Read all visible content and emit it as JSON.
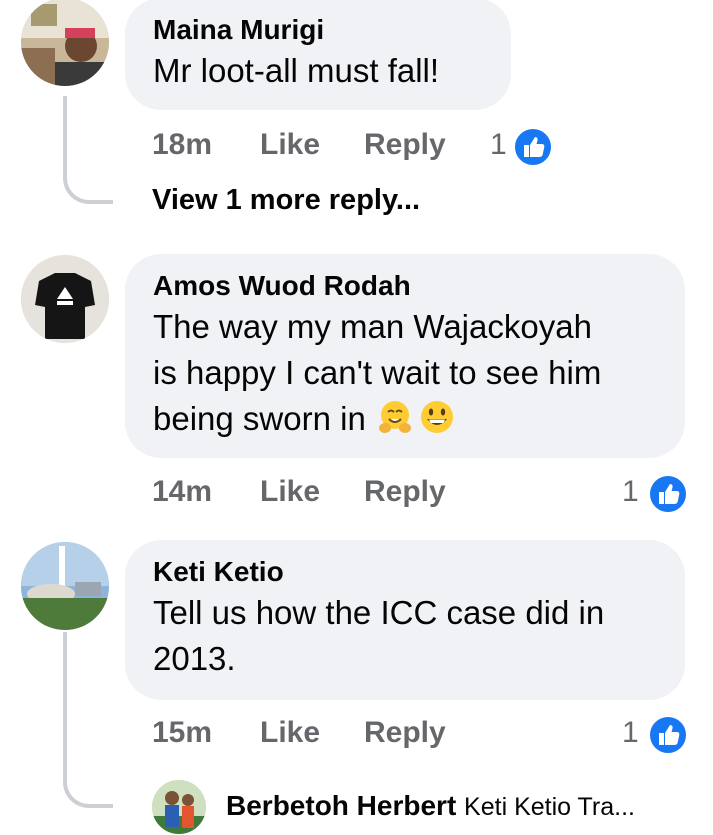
{
  "comments": [
    {
      "author": "Maina Murigi",
      "text": "Mr loot-all must fall!",
      "time": "18m",
      "like_label": "Like",
      "reply_label": "Reply",
      "reactions": "1",
      "view_more": "View 1 more reply..."
    },
    {
      "author": "Amos Wuod Rodah",
      "text_lines": [
        "The way my man Wajackoyah",
        "is happy I can't wait to see him",
        "being sworn in"
      ],
      "emojis": [
        "hugging-face-emoji",
        "grinning-face-emoji"
      ],
      "time": "14m",
      "like_label": "Like",
      "reply_label": "Reply",
      "reactions": "1"
    },
    {
      "author": "Keti Ketio",
      "text_lines": [
        "Tell us how the ICC case did in",
        "2013."
      ],
      "time": "15m",
      "like_label": "Like",
      "reply_label": "Reply",
      "reactions": "1",
      "reply_preview": {
        "author": "Berbetoh Herbert",
        "text": "Keti Ketio Tra..."
      }
    }
  ],
  "colors": {
    "bubble": "#f0f2f5",
    "meta": "#65676b",
    "like_blue": "#1877f2",
    "thread_line": "#ccd0d5"
  }
}
